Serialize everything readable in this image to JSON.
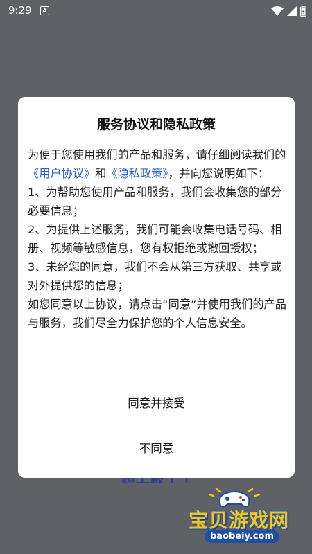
{
  "status_bar": {
    "time": "9:29",
    "notification_icon": "A"
  },
  "background": {
    "peek_text": "超上殿十十"
  },
  "dialog": {
    "title": "服务协议和隐私政策",
    "body": {
      "intro_prefix": "为便于您使用我们的产品和服务，请仔细阅读我们的",
      "user_agreement_link": "《用户协议》",
      "and": "和",
      "privacy_policy_link": "《隐私政策》",
      "intro_suffix": "，并向您说明如下：",
      "item1": "1、为帮助您使用产品和服务，我们会收集您的部分必要信息；",
      "item2": "2、为提供上述服务，我们可能会收集电话号码、相册、视频等敏感信息，您有权拒绝或撤回授权；",
      "item3": "3、未经您的同意，我们不会从第三方获取、共享或对外提供您的信息；",
      "closing": "如您同意以上协议，请点击“同意”并使用我们的产品与服务，我们尽全力保护您的个人信息安全。"
    },
    "accept_label": "同意并接受",
    "decline_label": "不同意"
  },
  "watermark": {
    "name": "宝贝游戏网",
    "url": "baobeiy.com"
  },
  "colors": {
    "overlay": "#5f6166",
    "link": "#2b5fd8",
    "watermark_yellow": "#f5c518",
    "watermark_blue": "#1e4fa5"
  }
}
